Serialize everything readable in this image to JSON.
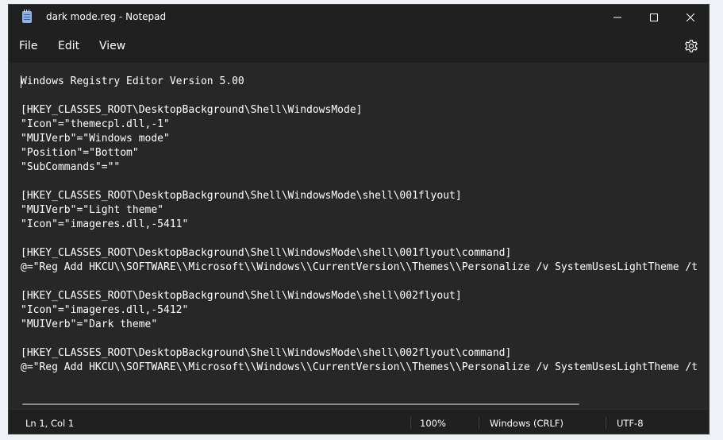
{
  "window": {
    "title": "dark mode.reg - Notepad",
    "app_icon": "notepad-icon"
  },
  "controls": {
    "minimize_icon": "minimize-icon",
    "maximize_icon": "maximize-icon",
    "close_icon": "close-icon"
  },
  "menu": {
    "items": [
      {
        "label": "File"
      },
      {
        "label": "Edit"
      },
      {
        "label": "View"
      }
    ],
    "settings_icon": "gear-icon"
  },
  "editor": {
    "lines": [
      "Windows Registry Editor Version 5.00",
      "",
      "[HKEY_CLASSES_ROOT\\DesktopBackground\\Shell\\WindowsMode]",
      "\"Icon\"=\"themecpl.dll,-1\"",
      "\"MUIVerb\"=\"Windows mode\"",
      "\"Position\"=\"Bottom\"",
      "\"SubCommands\"=\"\"",
      "",
      "[HKEY_CLASSES_ROOT\\DesktopBackground\\Shell\\WindowsMode\\shell\\001flyout]",
      "\"MUIVerb\"=\"Light theme\"",
      "\"Icon\"=\"imageres.dll,-5411\"",
      "",
      "[HKEY_CLASSES_ROOT\\DesktopBackground\\Shell\\WindowsMode\\shell\\001flyout\\command]",
      "@=\"Reg Add HKCU\\\\SOFTWARE\\\\Microsoft\\\\Windows\\\\CurrentVersion\\\\Themes\\\\Personalize /v SystemUsesLightTheme /t",
      "",
      "[HKEY_CLASSES_ROOT\\DesktopBackground\\Shell\\WindowsMode\\shell\\002flyout]",
      "\"Icon\"=\"imageres.dll,-5412\"",
      "\"MUIVerb\"=\"Dark theme\"",
      "",
      "[HKEY_CLASSES_ROOT\\DesktopBackground\\Shell\\WindowsMode\\shell\\002flyout\\command]",
      "@=\"Reg Add HKCU\\\\SOFTWARE\\\\Microsoft\\\\Windows\\\\CurrentVersion\\\\Themes\\\\Personalize /v SystemUsesLightTheme /t"
    ]
  },
  "status": {
    "position": "Ln 1, Col 1",
    "zoom": "100%",
    "line_ending": "Windows (CRLF)",
    "encoding": "UTF-8"
  },
  "colors": {
    "titlebar_bg": "#202020",
    "editor_bg": "#272727",
    "text": "#ffffff",
    "app_icon": "#8fb2e6"
  }
}
